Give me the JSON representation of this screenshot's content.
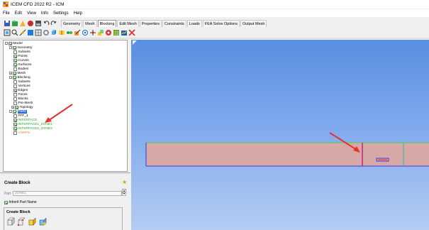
{
  "window": {
    "title": "ICEM CFD 2022 R2 - ICM"
  },
  "menu": [
    "File",
    "Edit",
    "View",
    "Info",
    "Settings",
    "Help"
  ],
  "tabs": [
    {
      "label": "Geometry",
      "active": false
    },
    {
      "label": "Mesh",
      "active": false
    },
    {
      "label": "Blocking",
      "active": true
    },
    {
      "label": "Edit Mesh",
      "active": false
    },
    {
      "label": "Properties",
      "active": false
    },
    {
      "label": "Constraints",
      "active": false
    },
    {
      "label": "Loads",
      "active": false
    },
    {
      "label": "FEA Solve Options",
      "active": false
    },
    {
      "label": "Output Mesh",
      "active": false
    }
  ],
  "tree": {
    "model": "Model",
    "geometry": "Geometry",
    "geometry_items": [
      "Subsets",
      "Points",
      "Curves",
      "Surfaces",
      "Bodies"
    ],
    "mesh": "Mesh",
    "blocking": "Blocking",
    "blocking_items": [
      "Subsets",
      "Vertices",
      "Edges",
      "Faces",
      "Blocks",
      "Pre-Mesh",
      "Topology"
    ],
    "parts": "Parts",
    "part_items": [
      "FFF_1",
      "INTERFACE",
      "INTERFACE1_ZONE1",
      "INTERFACE2_ZONE2",
      "VORFN"
    ]
  },
  "create_block": {
    "title": "Create Block",
    "part_label": "Part",
    "part_value": "ZONE1",
    "inherit_label": "Inherit Part Name",
    "inherit_checked": true,
    "group_label": "Create Block"
  },
  "colors": {
    "viewport_top": "#5a8ee0",
    "viewport_bottom": "#b4ccf2",
    "block_fill": "#d6a9a6",
    "block_edge_top": "#4fd24a",
    "block_edge_side": "#3b3bdc",
    "interface_line": "#cc1f7a",
    "annotation_arrow": "#e83030"
  }
}
